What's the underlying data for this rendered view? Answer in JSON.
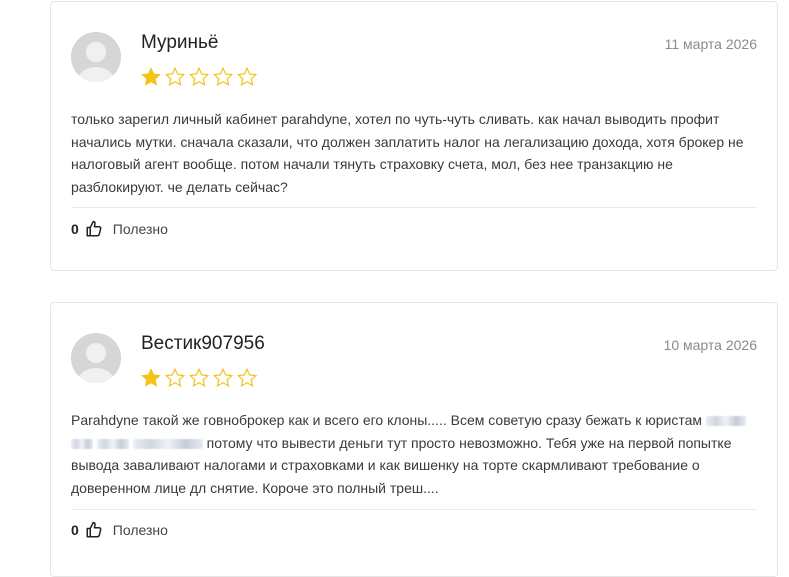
{
  "reviews": [
    {
      "author": "Муриньё",
      "date": "11 марта 2026",
      "rating": 1,
      "max_rating": 5,
      "text_parts": [
        "только зарегил личный кабинет parahdyne, хотел по чуть-чуть сливать. как начал выводить профит начались мутки. сначала сказали, что должен заплатить налог на легализацию дохода, хотя брокер не налоговый агент вообще. потом начали тянуть страховку счета, мол, без нее транзакцию не разблокируют. че делать сейчас?"
      ],
      "helpful_count": "0",
      "helpful_label": "Полезно"
    },
    {
      "author": "Вестик907956",
      "date": "10 марта 2026",
      "rating": 1,
      "max_rating": 5,
      "text_before": "Parahdyne такой же говноброкер как и всего его клоны..... Всем советую сразу бежать к юристам",
      "text_after": "потому что вывести деньги тут просто невозможно. Тебя уже на первой попытке вывода заваливают налогами и страховками и как вишенку на торте скармливают требование о доверенном лице дл снятие. Короче это полный треш....",
      "helpful_count": "0",
      "helpful_label": "Полезно"
    }
  ],
  "colors": {
    "star_filled": "#f2c318",
    "star_empty": "#f2c318",
    "border": "#e6e6e6"
  },
  "icons": [
    "avatar-placeholder-icon",
    "star-filled-icon",
    "star-empty-icon",
    "thumbs-up-icon"
  ]
}
